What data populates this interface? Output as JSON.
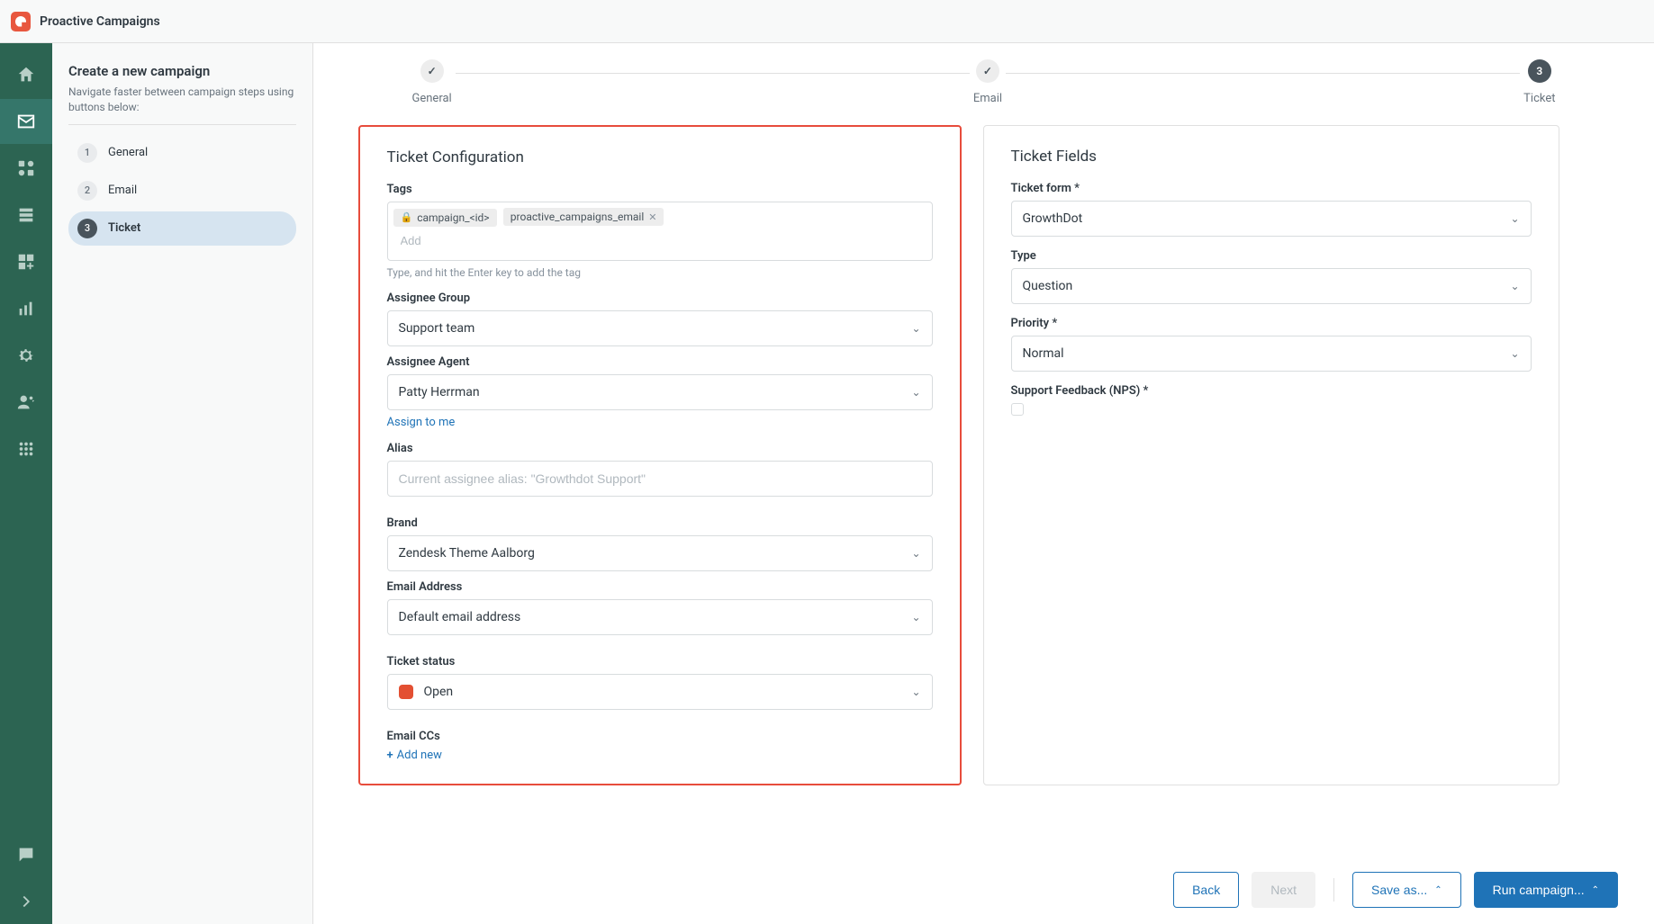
{
  "app": {
    "title": "Proactive Campaigns"
  },
  "sidebar": {
    "heading": "Create a new campaign",
    "subtext": "Navigate faster between campaign steps using buttons below:",
    "steps": [
      {
        "num": "1",
        "label": "General"
      },
      {
        "num": "2",
        "label": "Email"
      },
      {
        "num": "3",
        "label": "Ticket"
      }
    ]
  },
  "stepper": {
    "steps": [
      {
        "label": "General",
        "state": "done",
        "mark": "✓"
      },
      {
        "label": "Email",
        "state": "done",
        "mark": "✓"
      },
      {
        "label": "Ticket",
        "state": "current",
        "mark": "3"
      }
    ]
  },
  "ticket_config": {
    "title": "Ticket Configuration",
    "tags_label": "Tags",
    "tags": [
      {
        "text": "campaign_<id>",
        "locked": true
      },
      {
        "text": "proactive_campaigns_email",
        "locked": false
      }
    ],
    "tags_add_placeholder": "Add",
    "tags_hint": "Type, and hit the Enter key to add the tag",
    "assignee_group_label": "Assignee Group",
    "assignee_group_value": "Support team",
    "assignee_agent_label": "Assignee Agent",
    "assignee_agent_value": "Patty Herrman",
    "assign_to_me": "Assign to me",
    "alias_label": "Alias",
    "alias_placeholder": "Current assignee alias: \"Growthdot Support\"",
    "brand_label": "Brand",
    "brand_value": "Zendesk Theme Aalborg",
    "email_label": "Email Address",
    "email_value": "Default email address",
    "status_label": "Ticket status",
    "status_value": "Open",
    "status_color": "#E34F32",
    "ccs_label": "Email CCs",
    "ccs_add": "Add new"
  },
  "ticket_fields": {
    "title": "Ticket Fields",
    "form_label": "Ticket form *",
    "form_value": "GrowthDot",
    "type_label": "Type",
    "type_value": "Question",
    "priority_label": "Priority *",
    "priority_value": "Normal",
    "nps_label": "Support Feedback (NPS) *"
  },
  "footer": {
    "back": "Back",
    "next": "Next",
    "save": "Save as...",
    "run": "Run campaign..."
  }
}
